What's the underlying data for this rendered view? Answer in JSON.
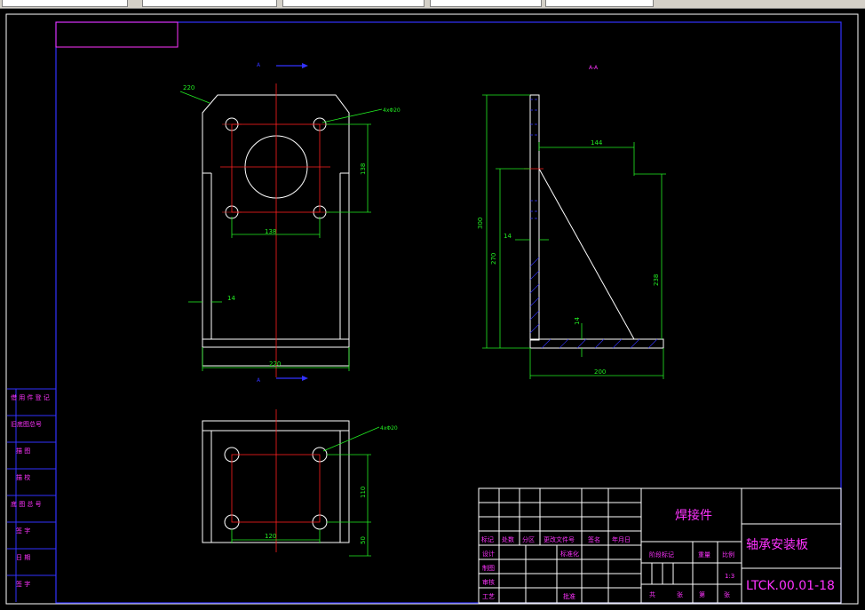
{
  "window": {
    "toolbar": {
      "fields": [
        "",
        "",
        "",
        "",
        "",
        ""
      ]
    }
  },
  "drawing": {
    "section_label": "A-A",
    "front_view": {
      "dim_top_width": "220",
      "dim_bottom_width": "220",
      "dim_hole_spacing_x": "138",
      "dim_hole_spacing_y": "138",
      "dim_thickness": "14",
      "hole_callout": "4xΦ20",
      "section_mark_top": "A",
      "section_mark_bottom": "A"
    },
    "side_view": {
      "dim_total_height": "300",
      "dim_inner_height": "270",
      "dim_plate_depth": "144",
      "dim_gusset_height": "238",
      "dim_thickness_left": "14",
      "dim_thickness_base": "14",
      "dim_base_width": "200"
    },
    "top_view": {
      "hole_callout": "4xΦ20",
      "dim_hole_spacing_x": "120",
      "dim_hole_spacing_y": "110",
      "dim_edge": "50"
    }
  },
  "side_table": {
    "rows": [
      "借 用 件 登 记",
      "旧底图总号",
      "描 图",
      "描 校",
      "底 图 总 号",
      "签 字",
      "日 期",
      "签 字"
    ]
  },
  "title_block": {
    "part_type": "焊接件",
    "part_name": "轴承安装板",
    "drawing_number": "LTCK.00.01-18",
    "scale_label": "比例",
    "scale_value": "1:3",
    "stage_label": "阶段标记",
    "weight_label": "重量",
    "header_cols": [
      "标记",
      "处数",
      "分区",
      "更改文件号",
      "签名",
      "年月日"
    ],
    "roles": [
      "设计",
      "制图",
      "审核",
      "工艺"
    ],
    "standardization": "标准化",
    "approve": "批准",
    "sheets_total": "共",
    "sheet_unit": "张",
    "sheet_no": "第",
    "sheet_unit2": "张"
  }
}
